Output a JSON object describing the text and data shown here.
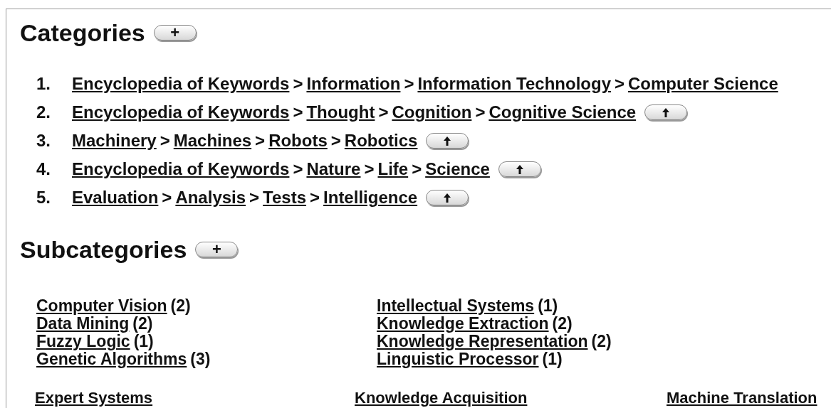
{
  "categories": {
    "heading": "Categories",
    "expand_button": "+",
    "items": [
      {
        "number": "1.",
        "path": [
          "Encyclopedia of Keywords",
          "Information",
          "Information Technology",
          "Computer Science"
        ],
        "separator": ">",
        "up_button": false
      },
      {
        "number": "2.",
        "path": [
          "Encyclopedia of Keywords",
          "Thought",
          "Cognition",
          "Cognitive Science"
        ],
        "separator": ">",
        "up_button": true
      },
      {
        "number": "3.",
        "path": [
          "Machinery",
          "Machines",
          "Robots",
          "Robotics"
        ],
        "separator": ">",
        "up_button": true
      },
      {
        "number": "4.",
        "path": [
          "Encyclopedia of Keywords",
          "Nature",
          "Life",
          "Science"
        ],
        "separator": ">",
        "up_button": true
      },
      {
        "number": "5.",
        "path": [
          "Evaluation",
          "Analysis",
          "Tests",
          "Intelligence"
        ],
        "separator": ">",
        "up_button": true
      }
    ]
  },
  "subcategories": {
    "heading": "Subcategories",
    "expand_button": "+",
    "columns": [
      [
        {
          "label": "Computer Vision",
          "count": "(2)"
        },
        {
          "label": "Data Mining",
          "count": "(2)"
        },
        {
          "label": "Fuzzy Logic",
          "count": "(1)"
        },
        {
          "label": "Genetic Algorithms",
          "count": "(3)"
        }
      ],
      [
        {
          "label": "Intellectual Systems",
          "count": "(1)"
        },
        {
          "label": "Knowledge Extraction",
          "count": "(2)"
        },
        {
          "label": "Knowledge Representation",
          "count": "(2)"
        },
        {
          "label": "Linguistic Processor",
          "count": "(1)"
        }
      ]
    ],
    "more_links": [
      "Expert Systems",
      "Knowledge Acquisition",
      "Machine Translation"
    ]
  }
}
